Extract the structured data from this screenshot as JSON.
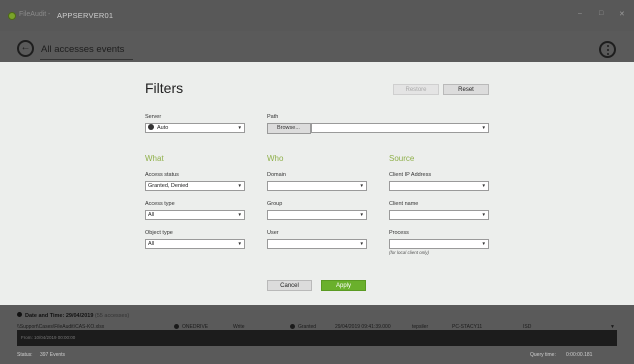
{
  "window": {
    "app_name": "FileAudit",
    "separator": "-",
    "server": "APPSERVER01",
    "controls": {
      "minimize": "–",
      "maximize": "□",
      "close": "✕"
    }
  },
  "header": {
    "title": "All accesses events",
    "back_icon": "arrow-left-icon",
    "more_icon": "more-vertical-icon"
  },
  "filters": {
    "title": "Filters",
    "restore_label": "Restore",
    "reset_label": "Reset",
    "server": {
      "label": "Server",
      "value": "Auto"
    },
    "path": {
      "label": "Path",
      "browse_label": "Browse...",
      "value": ""
    },
    "sections": {
      "what": "What",
      "who": "Who",
      "source": "Source"
    },
    "access_status": {
      "label": "Access status",
      "value": "Granted, Denied"
    },
    "access_type": {
      "label": "Access type",
      "value": "All"
    },
    "object_type": {
      "label": "Object type",
      "value": "All"
    },
    "domain": {
      "label": "Domain",
      "value": ""
    },
    "group": {
      "label": "Group",
      "value": ""
    },
    "user": {
      "label": "User",
      "value": ""
    },
    "client_ip": {
      "label": "Client IP Address",
      "value": ""
    },
    "client_name": {
      "label": "Client name",
      "value": ""
    },
    "process": {
      "label": "Process",
      "value": "",
      "hint": "(for local client only)"
    },
    "cancel_label": "Cancel",
    "apply_label": "Apply",
    "colors": {
      "section_accent": "#8fb04a",
      "apply": "#6ab02c"
    }
  },
  "results": {
    "group_label": "Date and Time: 29/04/2019",
    "group_count": "(55 accesses)",
    "row": {
      "path": "\\\\Support\\Cases\\FileAudit\\CAS-KO.xlsx",
      "object": "ONEDRIVE",
      "access": "Write",
      "status": "Granted",
      "date": "29/04/2019 09:41:39.000",
      "user": "tepsiler",
      "computer": "PC-STACY11",
      "extra": "ISD"
    },
    "from_text": "From: 10/04/2019 00:00:00"
  },
  "status_bar": {
    "status_label": "Status:",
    "events": "397 Events",
    "query_label": "Query time:",
    "query_value": "0:00:00.181"
  }
}
